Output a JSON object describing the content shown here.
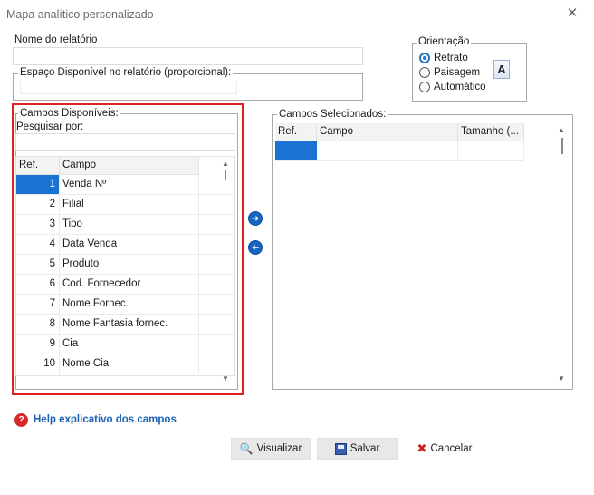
{
  "window": {
    "title": "Mapa analítico personalizado",
    "close_glyph": "✕"
  },
  "report_name": {
    "label": "Nome do relatório",
    "value": ""
  },
  "available_space": {
    "legend": "Espaço Disponível no relatório (proporcional):",
    "value": ""
  },
  "orientation": {
    "legend": "Orientação",
    "options": [
      "Retrato",
      "Paisagem",
      "Automático"
    ],
    "selected": "Retrato",
    "preview_letter": "A"
  },
  "available_fields": {
    "legend": "Campos Disponíveis:",
    "search_label": "Pesquisar por:",
    "search_value": "",
    "columns": [
      "Ref.",
      "Campo"
    ],
    "rows": [
      {
        "ref": "1",
        "campo": "Venda Nº"
      },
      {
        "ref": "2",
        "campo": "Filial"
      },
      {
        "ref": "3",
        "campo": "Tipo"
      },
      {
        "ref": "4",
        "campo": "Data Venda"
      },
      {
        "ref": "5",
        "campo": "Produto"
      },
      {
        "ref": "6",
        "campo": "Cod. Fornecedor"
      },
      {
        "ref": "7",
        "campo": "Nome Fornec."
      },
      {
        "ref": "8",
        "campo": "Nome Fantasia fornec."
      },
      {
        "ref": "9",
        "campo": "Cia"
      },
      {
        "ref": "10",
        "campo": "Nome Cia"
      }
    ],
    "highlight_color": "#e02020"
  },
  "selected_fields": {
    "legend": "Campos Selecionados:",
    "columns": [
      "Ref.",
      "Campo",
      "Tamanho (..."
    ]
  },
  "help": {
    "text": "Help explicativo dos campos",
    "icon": "help-icon"
  },
  "buttons": {
    "preview": "Visualizar",
    "save": "Salvar",
    "cancel": "Cancelar"
  },
  "colors": {
    "accent": "#1a73d2",
    "help_link": "#1d63b3"
  }
}
